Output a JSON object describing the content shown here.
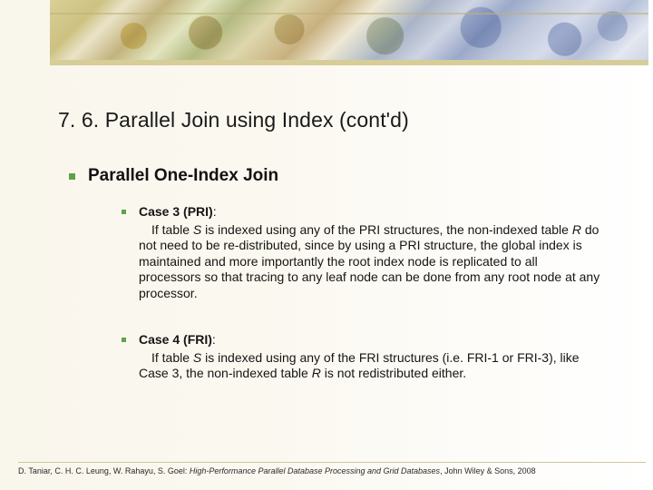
{
  "title": "7. 6. Parallel Join using Index (cont'd)",
  "bullet1": {
    "heading": "Parallel One-Index Join",
    "items": [
      {
        "label": "Case 3 (PRI)",
        "colon": ":",
        "pre": "If table ",
        "S": "S",
        "mid1": " is indexed using any of the PRI structures, the non-indexed table ",
        "R": "R",
        "post": " do not need to be re-distributed, since by using a PRI structure, the global index is maintained and more importantly the root index node is replicated to all processors so that tracing to any leaf node can be done from any root node at any processor."
      },
      {
        "label": "Case 4 (FRI)",
        "colon": ":",
        "pre": "If table ",
        "S": "S",
        "mid1": " is indexed using any of the FRI structures (i.e. FRI-1 or FRI-3), like Case 3, the non-indexed table ",
        "R": "R",
        "post": " is not redistributed either."
      }
    ]
  },
  "footer": {
    "authors": "D. Taniar, C. H. C. Leung, W. Rahayu, S. Goel: ",
    "title_italic": "High-Performance Parallel Database Processing and Grid Databases",
    "publisher": ", John Wiley & Sons, 2008"
  }
}
